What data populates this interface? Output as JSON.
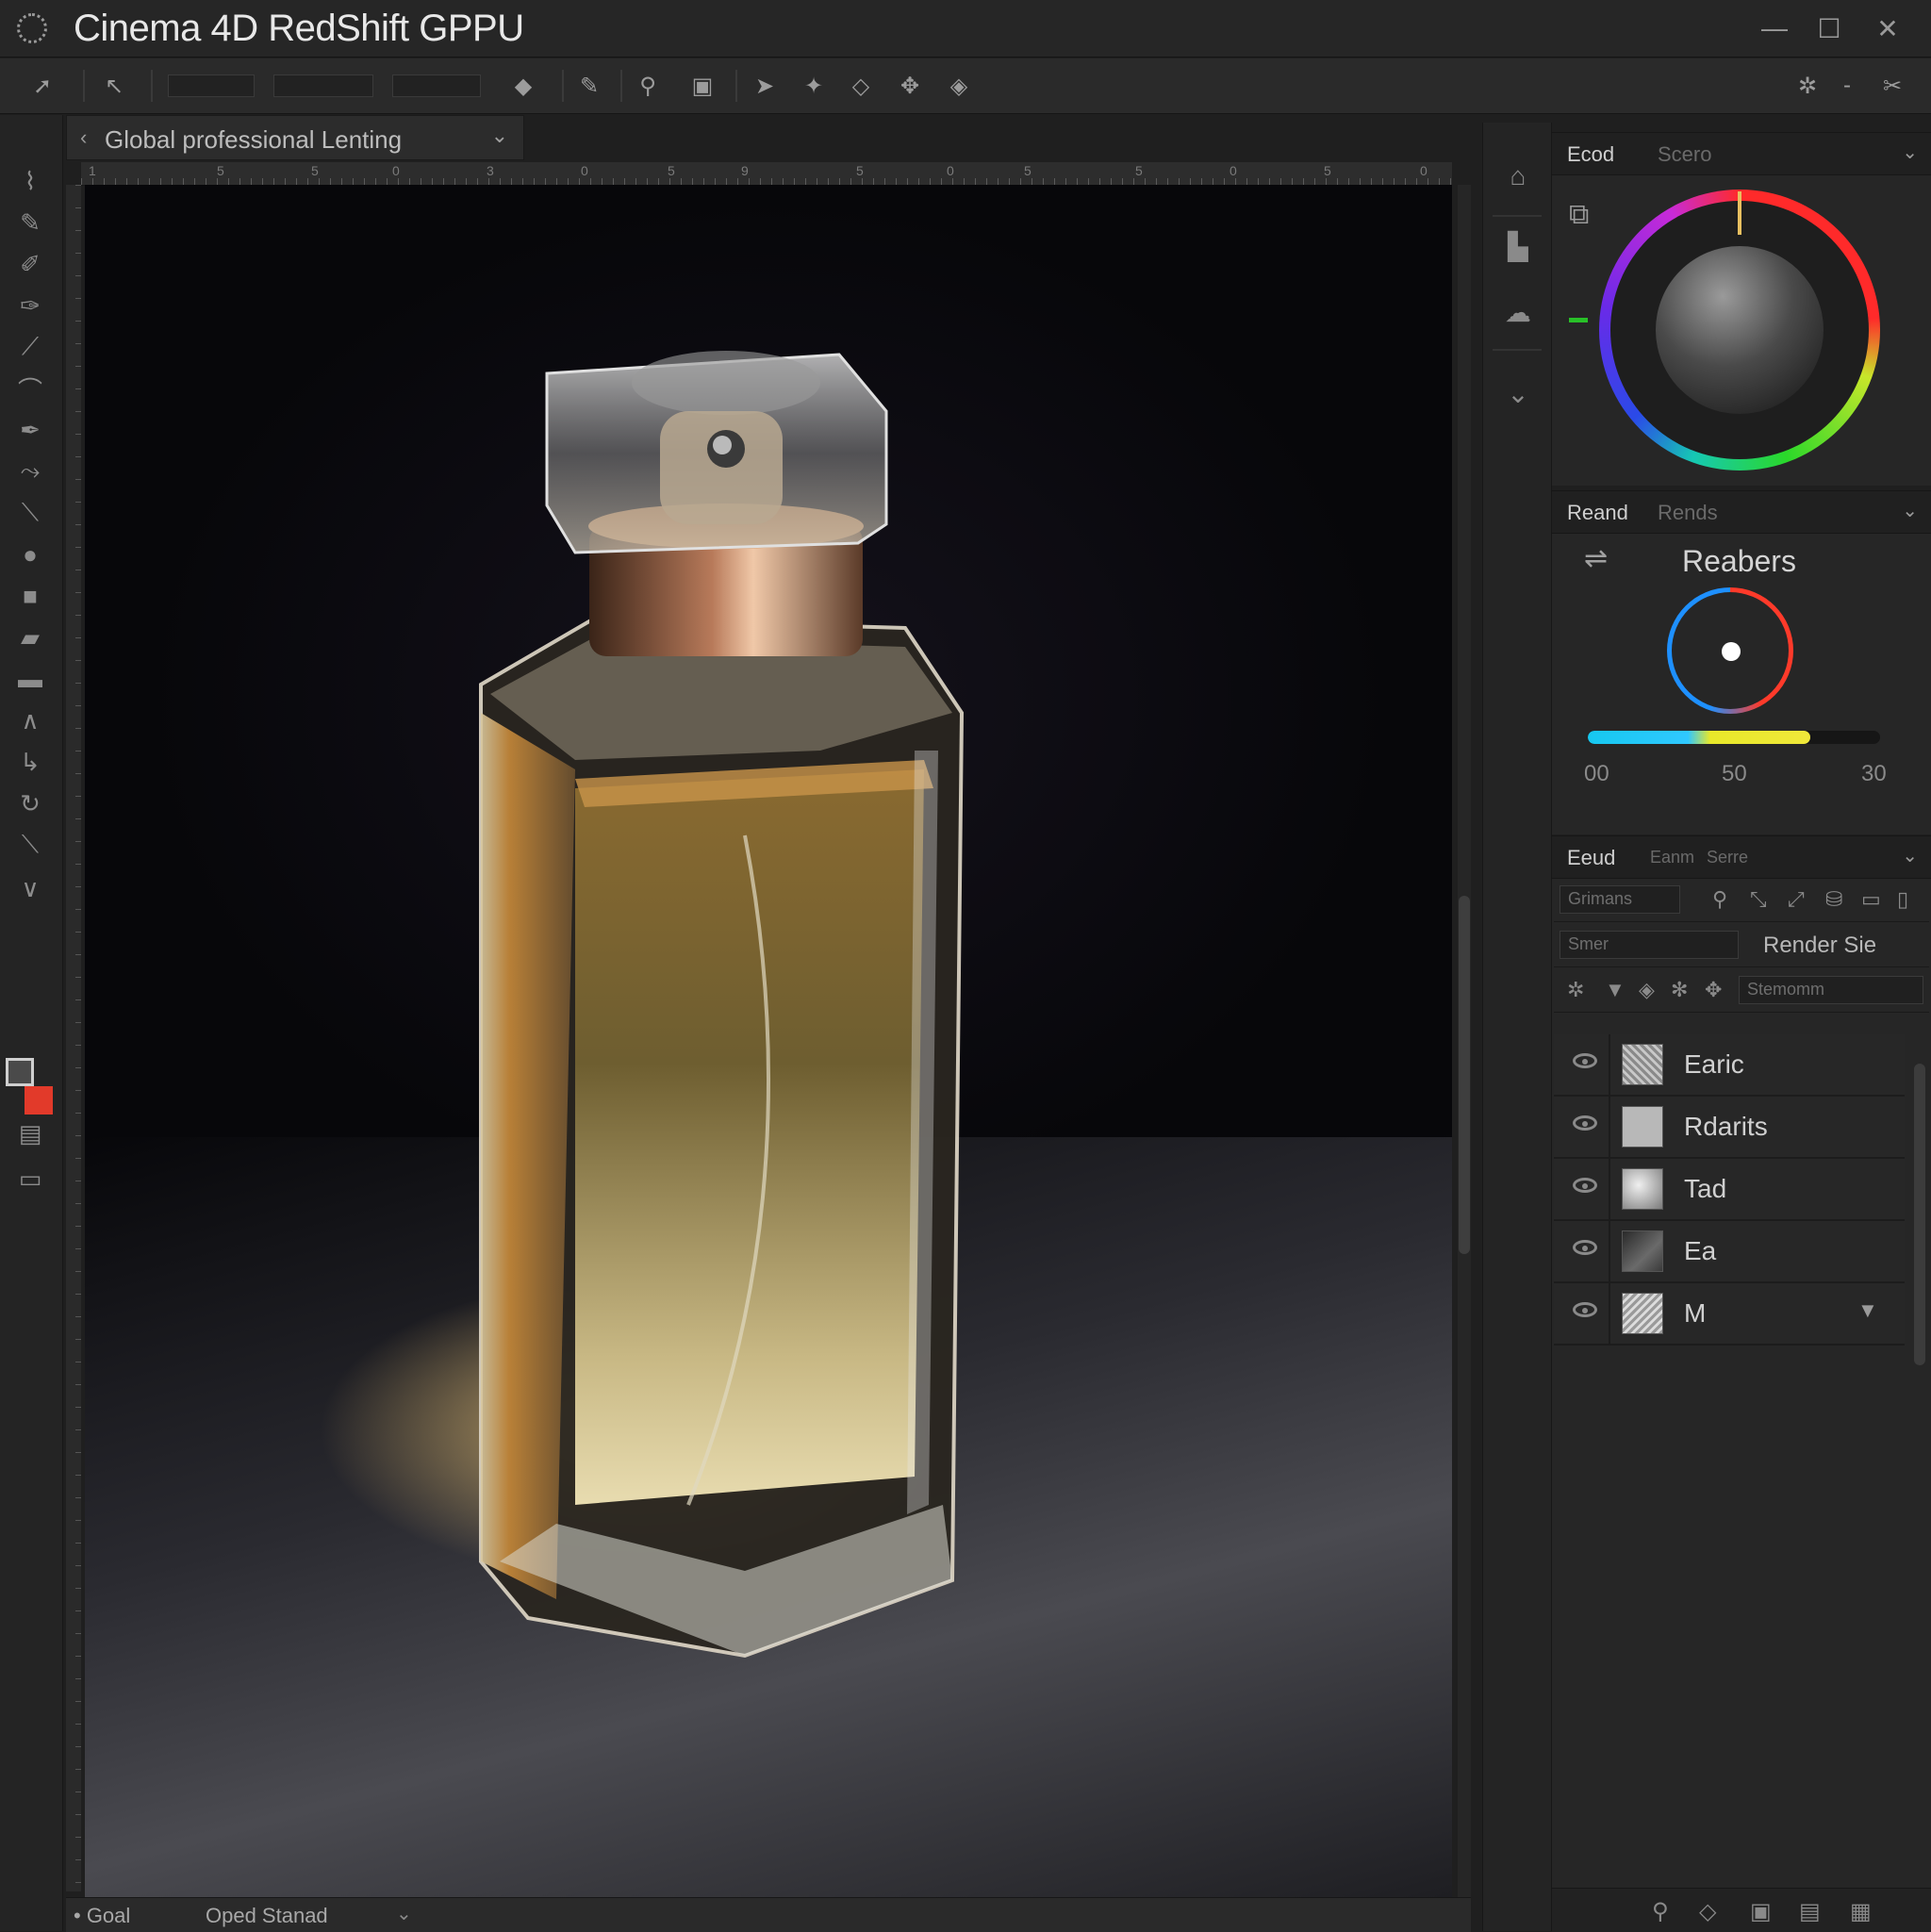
{
  "window": {
    "title": "Cinema 4D RedShift GPPU",
    "app_icon": "gear-icon",
    "controls": {
      "minimize": "—",
      "maximize": "☐",
      "close": "✕"
    }
  },
  "toolbar": {
    "field1": "",
    "field2": "",
    "field3": "",
    "right_minus": "-"
  },
  "document_tab": {
    "label": "Global professional Lenting",
    "chevron": "⌄"
  },
  "ruler": {
    "numbers": [
      "1",
      "5",
      "5",
      "0",
      "3",
      "0",
      "5",
      "9",
      "5",
      "0",
      "5",
      "5",
      "0",
      "5",
      "0"
    ]
  },
  "statusbar": {
    "left_text": "• Goal",
    "mid_text": "Oped Stanad",
    "chevron": "⌄"
  },
  "panels": {
    "color_panel": {
      "tabs": [
        "Ecod",
        "Scero"
      ],
      "active_tab": "Ecod"
    },
    "render_panel": {
      "tabs": [
        "Reand",
        "Rends"
      ],
      "title": "Reabers",
      "slider_percent": 76,
      "scale": [
        "00",
        "50",
        "30"
      ]
    },
    "layers_panel": {
      "tabs": [
        "Eeud",
        "Eanm",
        "Serre"
      ],
      "row1_select": "Grimans",
      "row2_select": "Smer",
      "row2_label": "Render Sie",
      "row3_label": "Stemomm",
      "layers": [
        {
          "name": "Earic"
        },
        {
          "name": "Rdarits"
        },
        {
          "name": "Tad"
        },
        {
          "name": "Ea"
        },
        {
          "name": "M"
        }
      ]
    }
  },
  "colors": {
    "accent_red": "#e23a2a",
    "slider_cyan": "#16c8f0",
    "slider_yellow": "#e8e82a",
    "marker_green": "#28c028"
  }
}
